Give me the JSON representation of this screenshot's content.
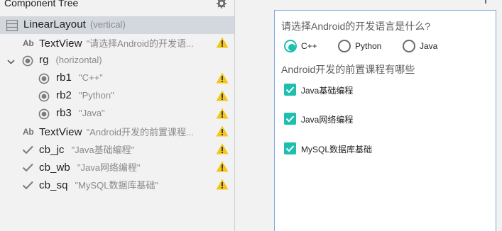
{
  "panel": {
    "title": "Component Tree"
  },
  "tree": {
    "root": {
      "name": "LinearLayout",
      "detail": "(vertical)"
    },
    "textview1": {
      "type_badge": "Ab",
      "name": "TextView",
      "detail": "\"请选择Android的开发语..."
    },
    "rg": {
      "name": "rg",
      "detail": "(horizontal)"
    },
    "rb1": {
      "name": "rb1",
      "detail": "\"C++\""
    },
    "rb2": {
      "name": "rb2",
      "detail": "\"Python\""
    },
    "rb3": {
      "name": "rb3",
      "detail": "\"Java\""
    },
    "textview2": {
      "type_badge": "Ab",
      "name": "TextView",
      "detail": "\"Android开发的前置课程..."
    },
    "cb_jc": {
      "name": "cb_jc",
      "detail": "\"Java基础编程\""
    },
    "cb_wb": {
      "name": "cb_wb",
      "detail": "\"Java网络编程\""
    },
    "cb_sq": {
      "name": "cb_sq",
      "detail": "\"MySQL数据库基础\""
    }
  },
  "preview": {
    "question": "请选择Android的开发语言是什么?",
    "radios": [
      {
        "label": "C++",
        "checked": true
      },
      {
        "label": "Python",
        "checked": false
      },
      {
        "label": "Java",
        "checked": false
      }
    ],
    "question2": "Android开发的前置课程有哪些",
    "checkboxes": [
      {
        "label": "Java基础编程",
        "checked": true
      },
      {
        "label": "Java网络编程",
        "checked": true
      },
      {
        "label": "MySQL数据库基础",
        "checked": true
      }
    ]
  },
  "colors": {
    "accent": "#1dbfae",
    "warning": "#f5c518",
    "selected_row": "#d3d7de",
    "device_border": "#7aa7dc"
  }
}
